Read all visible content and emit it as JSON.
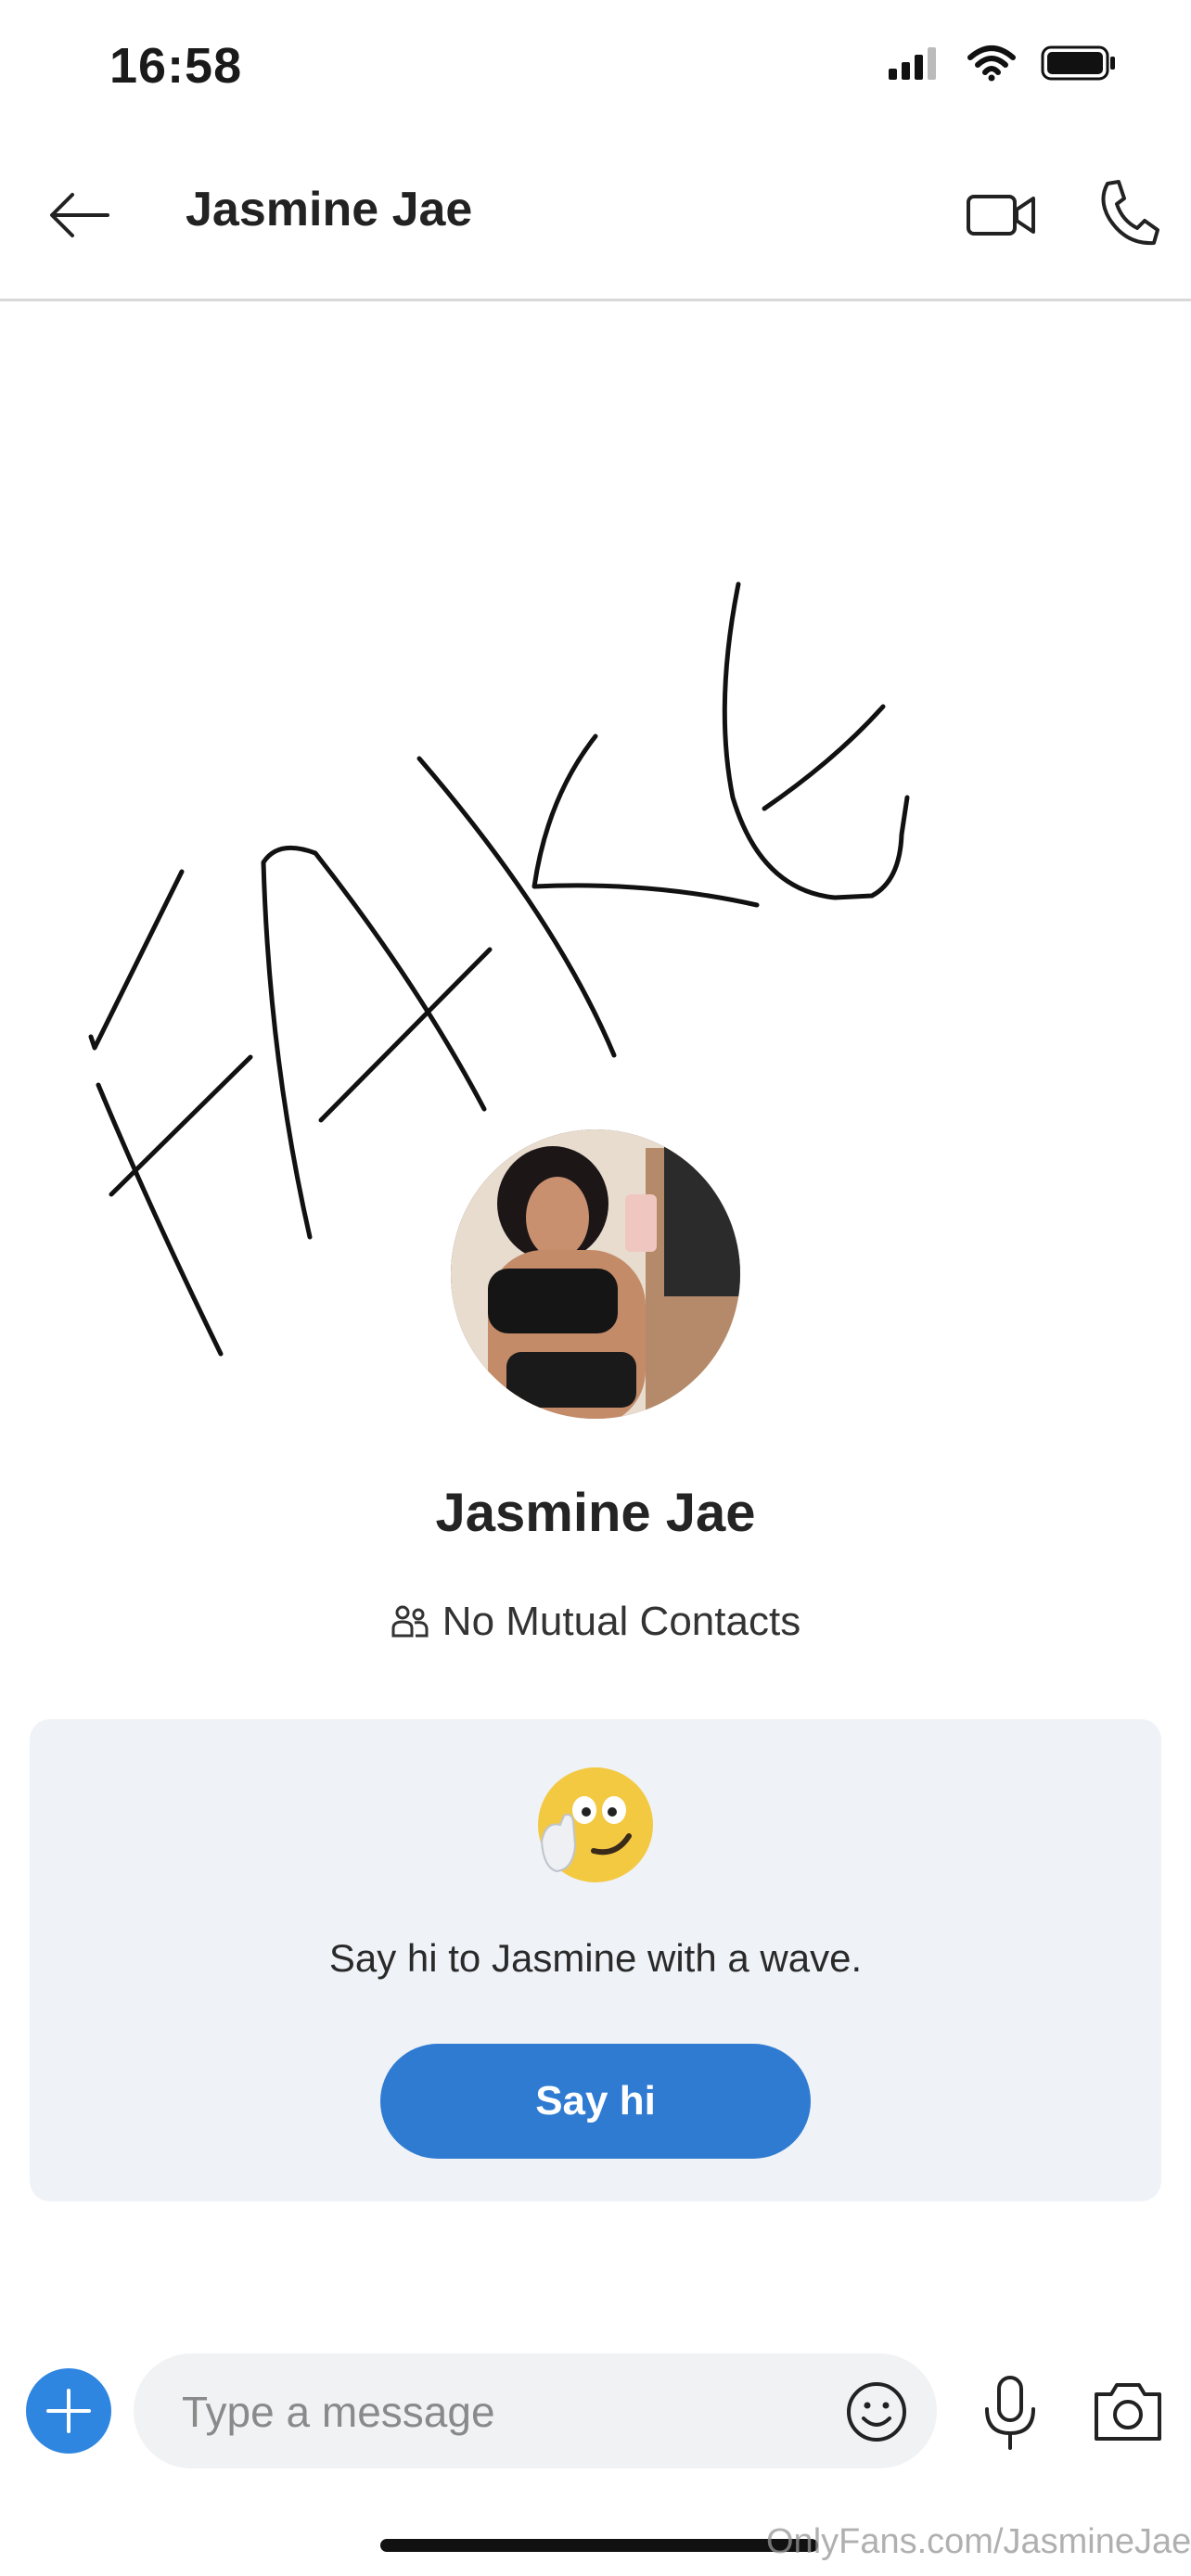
{
  "status_bar": {
    "time": "16:58"
  },
  "header": {
    "title": "Jasmine Jae"
  },
  "overlay": {
    "scribble_text": "FAKE"
  },
  "profile": {
    "name": "Jasmine Jae",
    "mutual_contacts": "No Mutual Contacts"
  },
  "wave_card": {
    "prompt": "Say hi to Jasmine with a wave.",
    "button_label": "Say hi"
  },
  "composer": {
    "placeholder": "Type a message"
  },
  "watermark": "OnlyFans.com/JasmineJae",
  "colors": {
    "accent": "#2f7bd2",
    "card_bg": "#eff2f7",
    "input_bg": "#f1f2f4"
  }
}
